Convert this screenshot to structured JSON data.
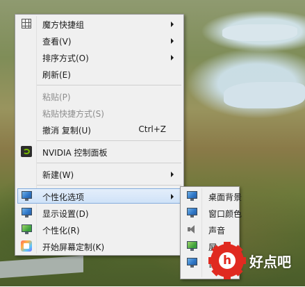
{
  "main_menu": {
    "items": [
      {
        "label": "魔方快捷组",
        "icon": "grid-icon",
        "submenu": true,
        "disabled": false
      },
      {
        "label": "查看(V)",
        "submenu": true,
        "disabled": false
      },
      {
        "label": "排序方式(O)",
        "submenu": true,
        "disabled": false
      },
      {
        "label": "刷新(E)",
        "submenu": false,
        "disabled": false
      },
      {
        "label": "粘贴(P)",
        "submenu": false,
        "disabled": true
      },
      {
        "label": "粘贴快捷方式(S)",
        "submenu": false,
        "disabled": true
      },
      {
        "label": "撤消 复制(U)",
        "shortcut": "Ctrl+Z",
        "submenu": false,
        "disabled": false
      },
      {
        "label": "NVIDIA 控制面板",
        "icon": "nvidia-icon",
        "submenu": false,
        "disabled": false
      },
      {
        "label": "新建(W)",
        "submenu": true,
        "disabled": false
      },
      {
        "label": "个性化选项",
        "icon": "monitor-icon",
        "submenu": true,
        "disabled": false,
        "highlighted": true
      },
      {
        "label": "显示设置(D)",
        "icon": "monitor-icon",
        "submenu": false,
        "disabled": false
      },
      {
        "label": "个性化(R)",
        "icon": "monitor-icon",
        "submenu": false,
        "disabled": false
      },
      {
        "label": "开始屏幕定制(K)",
        "icon": "start-icon",
        "submenu": false,
        "disabled": false
      }
    ]
  },
  "sub_menu": {
    "items": [
      {
        "label": "桌面背景",
        "icon": "monitor-icon"
      },
      {
        "label": "窗口颜色",
        "icon": "monitor-icon"
      },
      {
        "label": "声音",
        "icon": "speaker-icon"
      },
      {
        "label": "屏",
        "icon": "monitor-icon"
      },
      {
        "label": "鼠",
        "icon": "monitor-icon"
      }
    ]
  },
  "watermark": {
    "logo_text": "好点吧",
    "gear_letter": "h",
    "color": "#e02a20"
  },
  "colors": {
    "menu_bg": "#f0f0f0",
    "highlight_border": "#84acdd",
    "disabled_text": "#8e8e8e"
  }
}
